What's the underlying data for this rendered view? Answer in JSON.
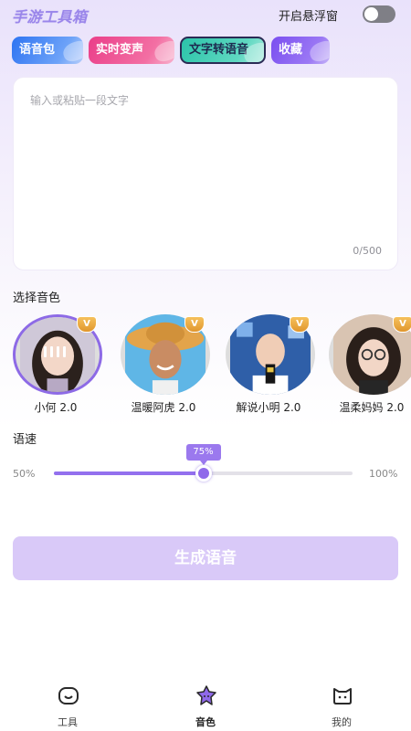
{
  "header": {
    "app_title": "手游工具箱",
    "floating_window_label": "开启悬浮窗",
    "floating_window_on": false
  },
  "tabs": [
    {
      "label": "语音包",
      "color": "#2e74f2"
    },
    {
      "label": "实时变声",
      "color": "#ea3e89"
    },
    {
      "label": "文字转语音",
      "color": "#2bc4a9",
      "active": true
    },
    {
      "label": "收藏",
      "color": "#7a4ef0"
    }
  ],
  "text_input": {
    "placeholder": "输入或粘贴一段文字",
    "value": "",
    "counter": "0/500"
  },
  "voice_section": {
    "title": "选择音色",
    "voices": [
      {
        "name": "小何 2.0",
        "badge": "V",
        "selected": true,
        "playing": true
      },
      {
        "name": "温暖阿虎 2.0",
        "badge": "V",
        "selected": false
      },
      {
        "name": "解说小明 2.0",
        "badge": "V",
        "selected": false
      },
      {
        "name": "温柔妈妈 2.0",
        "badge": "V",
        "selected": false
      }
    ]
  },
  "speed": {
    "title": "语速",
    "min_label": "50%",
    "max_label": "100%",
    "value_label": "75%",
    "fraction": 0.5
  },
  "generate_button": {
    "label": "生成语音",
    "color": "#d9c9f8"
  },
  "bottom_nav": [
    {
      "label": "工具",
      "icon": "smile-face-icon",
      "active": false
    },
    {
      "label": "音色",
      "icon": "star-face-icon",
      "active": true
    },
    {
      "label": "我的",
      "icon": "cat-face-icon",
      "active": false
    }
  ],
  "accent_color": "#8f69ea"
}
